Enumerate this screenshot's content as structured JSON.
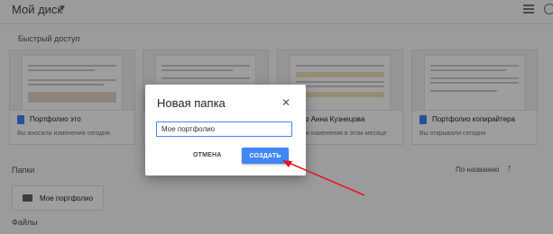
{
  "header": {
    "title": "Мой диск"
  },
  "quick_access": {
    "label": "Быстрый доступ",
    "cards": [
      {
        "name": "Портфолио это",
        "meta": "Вы вносили изменения сегодня"
      },
      {
        "name": "",
        "meta": ""
      },
      {
        "name": "тор Анна Кузнецова",
        "meta": "вносили изменения в этом месяце"
      },
      {
        "name": "Портфолио копирайтера",
        "meta": "Вы открывали сегодня"
      }
    ]
  },
  "folders": {
    "label": "Папки",
    "sort_label": "По названию",
    "items": [
      {
        "name": "Мое портфолио"
      }
    ]
  },
  "files": {
    "label": "Файлы"
  },
  "dialog": {
    "title": "Новая папка",
    "input_value": "Мое портфолио",
    "cancel_label": "ОТМЕНА",
    "create_label": "СОЗДАТЬ"
  },
  "colors": {
    "accent": "#4285f4",
    "arrow": "#e8131f"
  }
}
